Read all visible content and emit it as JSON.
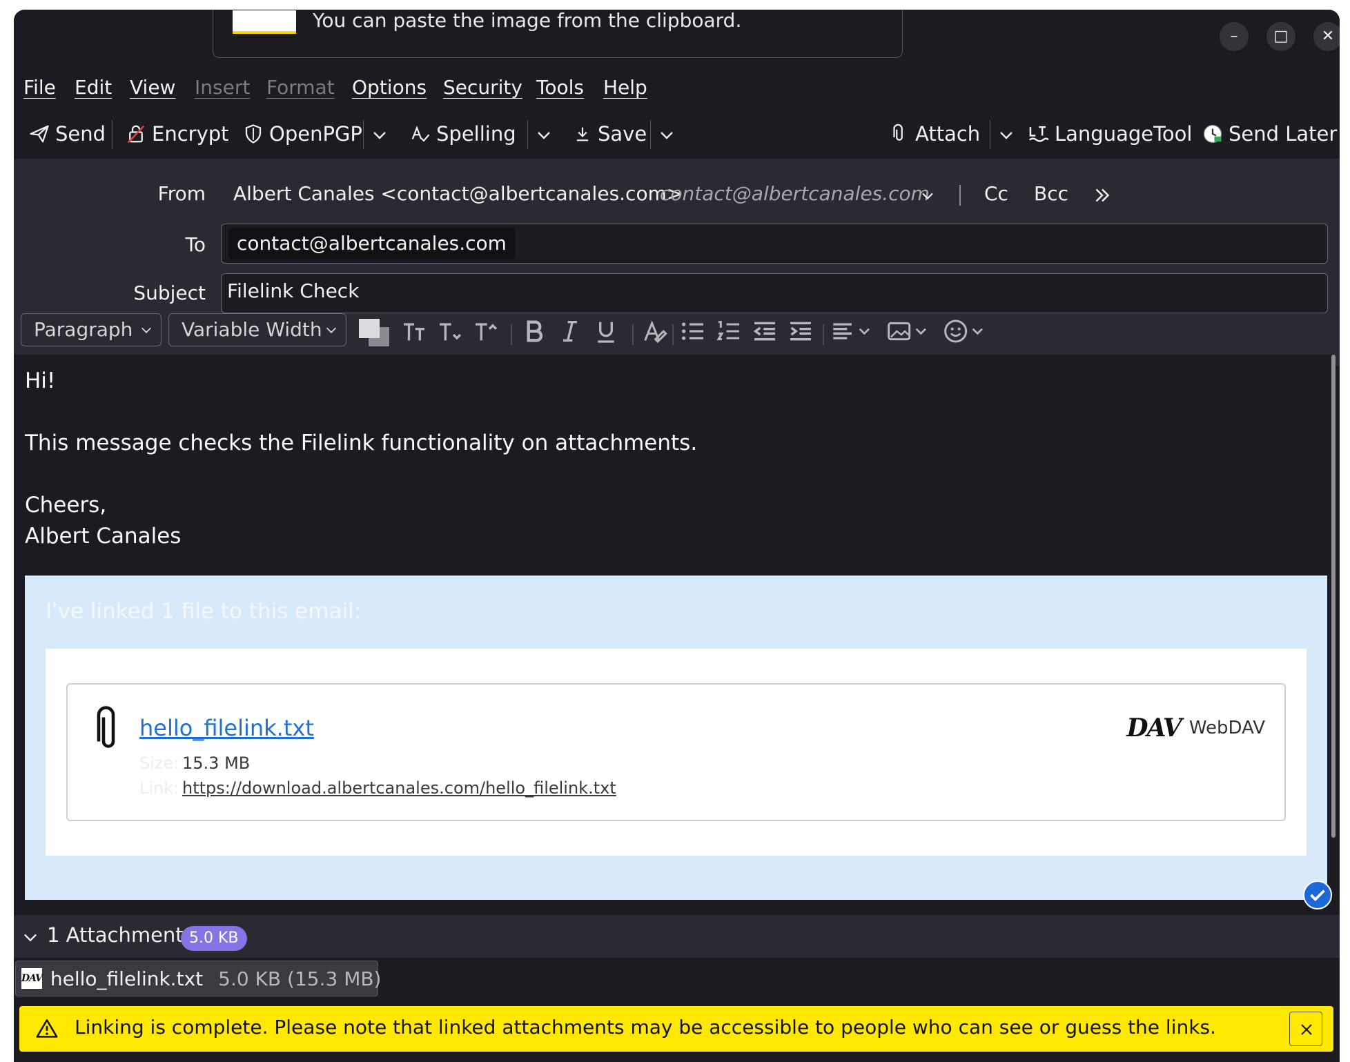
{
  "popup": {
    "text": "You can paste the image from the clipboard."
  },
  "window_controls": {
    "minimize": "–",
    "maximize": "□",
    "close": "✕"
  },
  "menu": {
    "file": "File",
    "edit": "Edit",
    "view": "View",
    "insert": "Insert",
    "format": "Format",
    "options": "Options",
    "security": "Security",
    "tools": "Tools",
    "help": "Help"
  },
  "toolbar": {
    "send": "Send",
    "encrypt": "Encrypt",
    "openpgp": "OpenPGP",
    "spelling": "Spelling",
    "save": "Save",
    "attach": "Attach",
    "languagetool": "LanguageTool",
    "send_later": "Send Later"
  },
  "header": {
    "from_label": "From",
    "from_value": "Albert Canales <contact@albertcanales.com>",
    "from_alt": "contact@albertcanales.com",
    "cc": "Cc",
    "bcc": "Bcc",
    "to_label": "To",
    "to_recipient": "contact@albertcanales.com",
    "subject_label": "Subject",
    "subject_value": "Filelink Check"
  },
  "format_bar": {
    "paragraph": "Paragraph",
    "font": "Variable Width"
  },
  "body": {
    "lines": [
      "Hi!",
      "This message checks the Filelink functionality on attachments.",
      "Cheers,",
      "Albert Canales"
    ]
  },
  "filelink": {
    "heading": "I've linked 1 file to this email:",
    "file_name": "hello_filelink.txt",
    "size_label": "Size:",
    "size_value": "15.3 MB",
    "link_label": "Link:",
    "link_value": "https://download.albertcanales.com/hello_filelink.txt",
    "provider": "WebDAV",
    "provider_logo": "DAV"
  },
  "attachments": {
    "title": "1 Attachment",
    "badge": "5.0 KB",
    "items": [
      {
        "name": "hello_filelink.txt",
        "size": "5.0 KB (15.3 MB)",
        "logo": "DAV"
      }
    ]
  },
  "notification": {
    "text": "Linking is complete. Please note that linked attachments may be accessible to people who can see or guess the links."
  },
  "colors": {
    "window_bg": "#1c1b22",
    "header_bg": "#2b2a33",
    "filelink_bg": "#d8e9fb",
    "link": "#1f6fd6",
    "badge": "#8673e5",
    "notification": "#ffe900"
  }
}
